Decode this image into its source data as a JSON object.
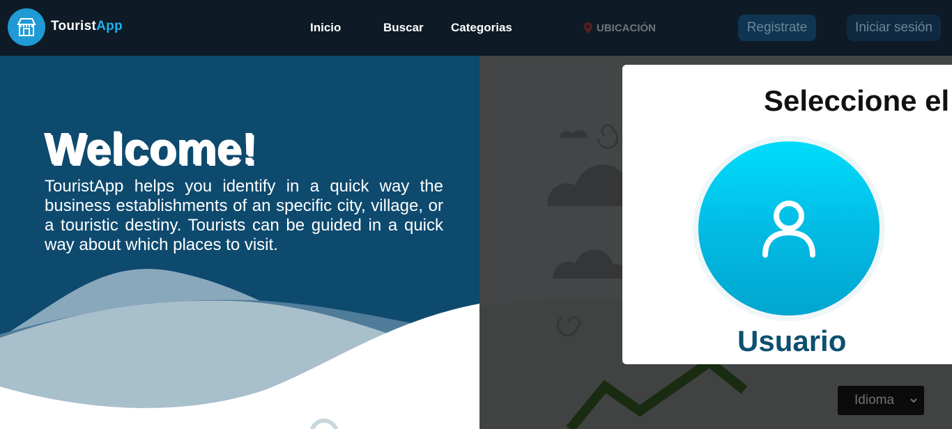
{
  "header": {
    "brand_primary": "Tourist",
    "brand_accent": "App",
    "nav": {
      "home": "Inicio",
      "search": "Buscar",
      "categories": "Categorias"
    },
    "location_label": "UBICACIÓN",
    "register_label": "Registrate",
    "login_label": "Iniciar sesión"
  },
  "hero": {
    "title": "Welcome!",
    "description": "TouristApp helps you identify in a quick way the business establishments of an specific city, village, or a touristic destiny. Tourists can be guided in a quick way about which places to visit."
  },
  "modal": {
    "title": "Seleccione el t",
    "option_label": "Usuario",
    "option_icon": "user-icon"
  },
  "language_select": {
    "selected": "Idioma"
  },
  "colors": {
    "brand_accent": "#1fb0ee",
    "hero_bg": "#0e4a6e",
    "header_bg": "#0e1b26",
    "user_circle": "#03b9e2",
    "modal_label": "#0d4f70"
  }
}
